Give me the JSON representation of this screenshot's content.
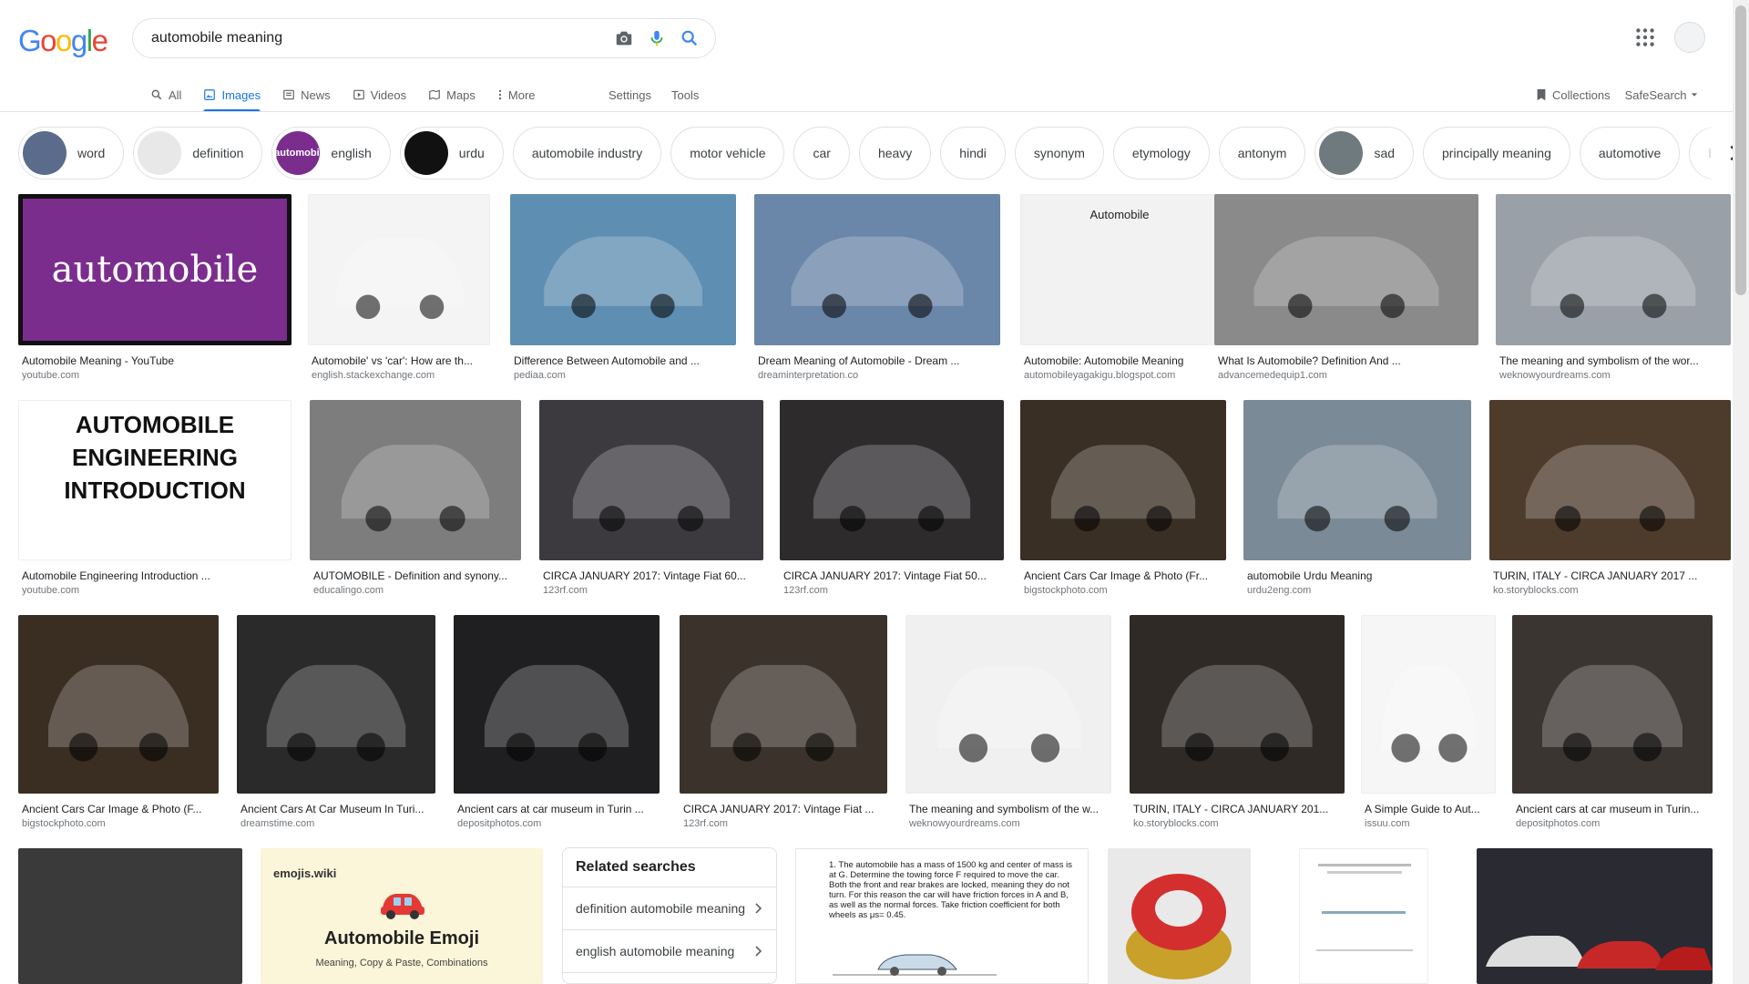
{
  "logo": {
    "letters": [
      "G",
      "o",
      "o",
      "g",
      "l",
      "e"
    ],
    "colors": [
      "#4285f4",
      "#ea4335",
      "#fbbc05",
      "#4285f4",
      "#34a853",
      "#ea4335"
    ]
  },
  "search": {
    "query": "automobile meaning"
  },
  "tabs": [
    {
      "label": "All",
      "icon": "search-icon"
    },
    {
      "label": "Images",
      "icon": "image-icon",
      "active": true
    },
    {
      "label": "News",
      "icon": "news-icon"
    },
    {
      "label": "Videos",
      "icon": "video-icon"
    },
    {
      "label": "Maps",
      "icon": "map-icon"
    },
    {
      "label": "More",
      "icon": "more-vert-icon"
    }
  ],
  "tools": {
    "settings": "Settings",
    "tools": "Tools"
  },
  "right_tools": {
    "collections": "Collections",
    "safesearch": "SafeSearch"
  },
  "chips": [
    {
      "label": "word",
      "thumb": "#5a6b8c"
    },
    {
      "label": "definition",
      "thumb": "#e8e8e8"
    },
    {
      "label": "english",
      "thumb": "#7b2d8e",
      "thumb_text": "automobil"
    },
    {
      "label": "urdu",
      "thumb": "#111111"
    },
    {
      "label": "automobile industry"
    },
    {
      "label": "motor vehicle"
    },
    {
      "label": "car"
    },
    {
      "label": "heavy"
    },
    {
      "label": "hindi"
    },
    {
      "label": "synonym"
    },
    {
      "label": "etymology"
    },
    {
      "label": "antonym"
    },
    {
      "label": "sad",
      "thumb": "#6f7a7f"
    },
    {
      "label": "principally meaning"
    },
    {
      "label": "automotive"
    },
    {
      "label": "ha"
    }
  ],
  "rows": [
    [
      {
        "title": "Automobile Meaning - YouTube",
        "source": "youtube.com",
        "bg": "#7b2d8e",
        "text": "automobile"
      },
      {
        "title": "Automobile' vs 'car': How are th...",
        "source": "english.stackexchange.com",
        "bg": "#f4f4f4"
      },
      {
        "title": "Difference Between Automobile and ...",
        "source": "pediaa.com",
        "bg": "#5e8fb3"
      },
      {
        "title": "Dream Meaning of Automobile - Dream ...",
        "source": "dreaminterpretation.co",
        "bg": "#6a86a8"
      },
      {
        "title": "Automobile: Automobile Meaning",
        "source": "automobileyagakigu.blogspot.com",
        "bg": "#f2f2f2",
        "text": "Automobile"
      },
      {
        "title": "What Is Automobile? Definition And ...",
        "source": "advancemedequip1.com",
        "bg": "#8a8a8a"
      },
      {
        "title": "The meaning and symbolism of the wor...",
        "source": "weknowyourdreams.com",
        "bg": "#9aa0a8"
      }
    ],
    [
      {
        "title": "Automobile Engineering Introduction ...",
        "source": "youtube.com",
        "bg": "#ffffff",
        "text": "AUTOMOBILE ENGINEERING INTRODUCTION"
      },
      {
        "title": "AUTOMOBILE - Definition and synony...",
        "source": "educalingo.com",
        "bg": "#7d7d7d"
      },
      {
        "title": "CIRCA JANUARY 2017: Vintage Fiat 60...",
        "source": "123rf.com",
        "bg": "#3d3a3f"
      },
      {
        "title": "CIRCA JANUARY 2017: Vintage Fiat 50...",
        "source": "123rf.com",
        "bg": "#2e2b2d"
      },
      {
        "title": "Ancient Cars Car Image & Photo (Fr...",
        "source": "bigstockphoto.com",
        "bg": "#3a2f24"
      },
      {
        "title": "automobile Urdu Meaning",
        "source": "urdu2eng.com",
        "bg": "#7a8a96"
      },
      {
        "title": "TURIN, ITALY - CIRCA JANUARY 2017 ...",
        "source": "ko.storyblocks.com",
        "bg": "#4d3b2c"
      }
    ],
    [
      {
        "title": "Ancient Cars Car Image & Photo (F...",
        "source": "bigstockphoto.com",
        "bg": "#3a2e22"
      },
      {
        "title": "Ancient Cars At Car Museum In Turi...",
        "source": "dreamstime.com",
        "bg": "#2a2a2a"
      },
      {
        "title": "Ancient cars at car museum in Turin ...",
        "source": "depositphotos.com",
        "bg": "#1f1f22"
      },
      {
        "title": "CIRCA JANUARY 2017: Vintage Fiat ...",
        "source": "123rf.com",
        "bg": "#3b332b"
      },
      {
        "title": "The meaning and symbolism of the w...",
        "source": "weknowyourdreams.com",
        "bg": "#f0f0f0"
      },
      {
        "title": "TURIN, ITALY - CIRCA JANUARY 201...",
        "source": "ko.storyblocks.com",
        "bg": "#2f2a26"
      },
      {
        "title": "A Simple Guide to Aut...",
        "source": "issuu.com",
        "bg": "#f6f6f6"
      },
      {
        "title": "Ancient cars at car museum in Turin...",
        "source": "depositphotos.com",
        "bg": "#3b3532"
      }
    ]
  ],
  "row4": [
    {
      "bg": "#3a3a3a"
    },
    {
      "bg": "#fbf5d9",
      "brand": "emojis.wiki",
      "title": "Automobile Emoji",
      "subtitle": "Meaning, Copy & Paste, Combinations"
    },
    {
      "bg": "#ffffff",
      "text": "1. The automobile has a mass of 1500 kg and center of mass is at G. Determine the towing force F required to move the car. Both the front and rear brakes are locked, meaning they do not turn. For this reason the car will have friction forces in A and B, as well as the normal forces. Take friction coefficient for both wheels as μs= 0.45."
    },
    {
      "bg": "#e9e9e9"
    },
    {
      "bg": "#ffffff"
    },
    {
      "bg": "#2a2a33"
    }
  ],
  "related": {
    "title": "Related searches",
    "items": [
      "definition automobile meaning",
      "english automobile meaning"
    ]
  }
}
